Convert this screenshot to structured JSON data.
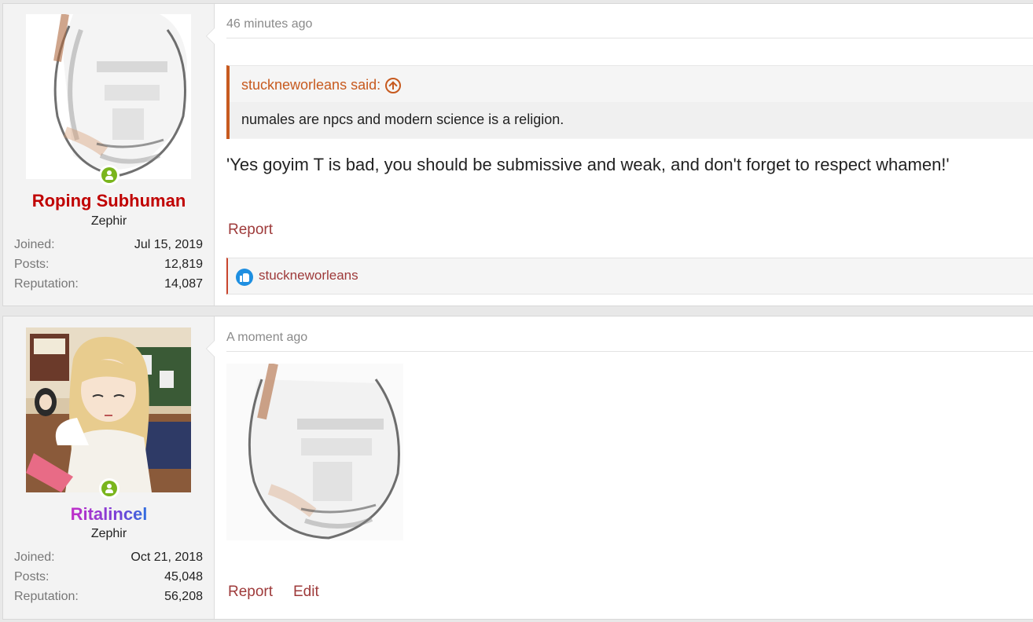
{
  "posts": [
    {
      "user": {
        "name": "Roping Subhuman",
        "name_color": "#c00000",
        "title": "Zephir",
        "avatar_icon": "sketch-face-avatar",
        "stats": [
          {
            "label": "Joined:",
            "value": "Jul 15, 2019"
          },
          {
            "label": "Posts:",
            "value": "12,819"
          },
          {
            "label": "Reputation:",
            "value": "14,087"
          }
        ]
      },
      "time": "46 minutes ago",
      "quote": {
        "author": "stuckneworleans said:",
        "text": "numales are npcs and modern science is a religion."
      },
      "message": "'Yes goyim T is bad, you should be submissive and weak, and don't forget to respect whamen!'",
      "actions": {
        "report": "Report"
      },
      "reaction": {
        "icon": "like-icon",
        "user": "stuckneworleans"
      }
    },
    {
      "user": {
        "name": "Ritalincel",
        "name_gradient": [
          "#c12fc9",
          "#7b3fd6",
          "#2f6ee0"
        ],
        "title": "Zephir",
        "avatar_icon": "anime-girl-avatar",
        "stats": [
          {
            "label": "Joined:",
            "value": "Oct 21, 2018"
          },
          {
            "label": "Posts:",
            "value": "45,048"
          },
          {
            "label": "Reputation:",
            "value": "56,208"
          }
        ]
      },
      "time": "A moment ago",
      "image_icon": "sketch-face-image",
      "actions": {
        "report": "Report",
        "edit": "Edit"
      }
    }
  ],
  "colors": {
    "accent": "#9e3a3a",
    "quote_accent": "#c75a1f",
    "online": "#7ab51d",
    "like": "#1e8fe1"
  }
}
